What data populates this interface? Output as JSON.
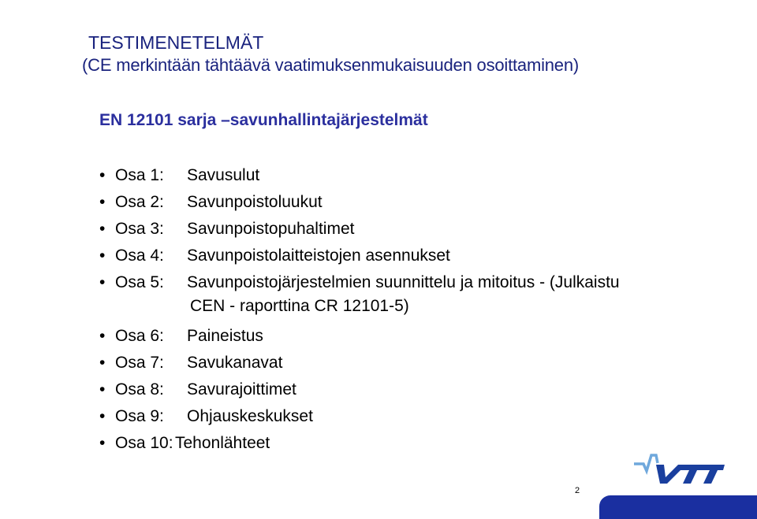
{
  "title": "TESTIMENETELMÄT",
  "subtitle": "(CE merkintään tähtäävä vaatimuksenmukaisuuden osoittaminen)",
  "section_heading": "EN 12101 sarja –savunhallintajärjestelmät",
  "bullet_glyph": "•",
  "items": [
    {
      "osa": "Osa 1:",
      "desc": "Savusulut"
    },
    {
      "osa": "Osa 2:",
      "desc": "Savunpoistoluukut"
    },
    {
      "osa": "Osa 3:",
      "desc": "Savunpoistopuhaltimet"
    },
    {
      "osa": "Osa 4:",
      "desc": "Savunpoistolaitteistojen asennukset"
    },
    {
      "osa": "Osa 5:",
      "desc": "Savunpoistojärjestelmien suunnittelu ja mitoitus - (Julkaistu",
      "desc_cont": "CEN - raporttina CR 12101-5)"
    },
    {
      "osa": "Osa 6:",
      "desc": "Paineistus"
    },
    {
      "osa": "Osa 7:",
      "desc": "Savukanavat"
    },
    {
      "osa": "Osa 8:",
      "desc": "Savurajoittimet"
    },
    {
      "osa": "Osa 9:",
      "desc": "Ohjauskeskukset"
    },
    {
      "osa": "Osa 10:",
      "desc": "Tehonlähteet"
    }
  ],
  "page_number": "2",
  "logo": {
    "text": "VTT",
    "icon": "vtt-logo-icon",
    "primary_color": "#1a3f9e",
    "accent_color": "#6fa8dc"
  },
  "colors": {
    "title": "#1a237e",
    "heading": "#2b2f9e",
    "bar": "#1a2fa0"
  }
}
